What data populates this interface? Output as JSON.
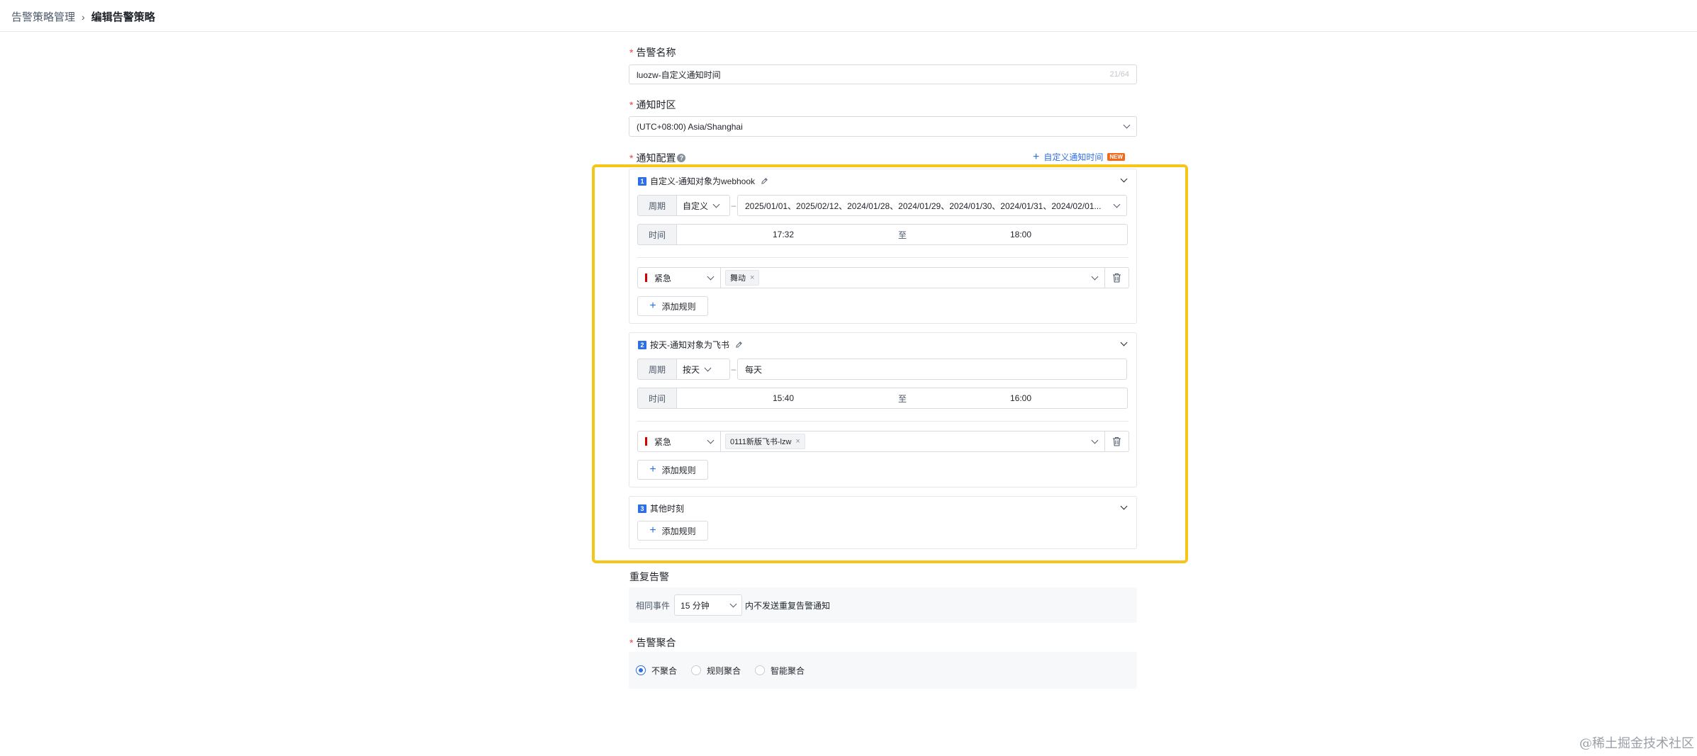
{
  "breadcrumb": {
    "parent": "告警策略管理",
    "current": "编辑告警策略"
  },
  "alert_name": {
    "label": "告警名称",
    "value": "luozw-自定义通知时间",
    "counter": "21/64"
  },
  "timezone": {
    "label": "通知时区",
    "value": "(UTC+08:00) Asia/Shanghai"
  },
  "notify_config": {
    "label": "通知配置",
    "help_icon": "question-icon",
    "add_custom_time": "自定义通知时间",
    "new_badge": "NEW",
    "cards": [
      {
        "index": "1",
        "title": "自定义-通知对象为webhook",
        "period_label": "周期",
        "period_value": "自定义",
        "period_detail": "2025/01/01、2025/02/12、2024/01/28、2024/01/29、2024/01/30、2024/01/31、2024/02/01...",
        "time_label": "时间",
        "time_from": "17:32",
        "time_to_word": "至",
        "time_to": "18:00",
        "rule_level": "紧急",
        "rule_receiver": "舞动",
        "add_rule": "添加规则"
      },
      {
        "index": "2",
        "title": "按天-通知对象为飞书",
        "period_label": "周期",
        "period_value": "按天",
        "period_detail": "每天",
        "time_label": "时间",
        "time_from": "15:40",
        "time_to_word": "至",
        "time_to": "16:00",
        "rule_level": "紧急",
        "rule_receiver": "0111新版飞书-lzw",
        "add_rule": "添加规则"
      },
      {
        "index": "3",
        "title": "其他时刻",
        "add_rule": "添加规则"
      }
    ]
  },
  "repeat_alert": {
    "label": "重复告警",
    "prefix": "相同事件",
    "interval": "15 分钟",
    "suffix": "内不发送重复告警通知"
  },
  "aggregation": {
    "label": "告警聚合",
    "options": [
      "不聚合",
      "规则聚合",
      "智能聚合"
    ],
    "selected": "不聚合"
  },
  "watermark": "@稀土掘金技术社区",
  "colors": {
    "accent": "#2e6ee6",
    "urgent": "#d40000",
    "highlight": "#f5c518",
    "required": "#f53f3f"
  }
}
